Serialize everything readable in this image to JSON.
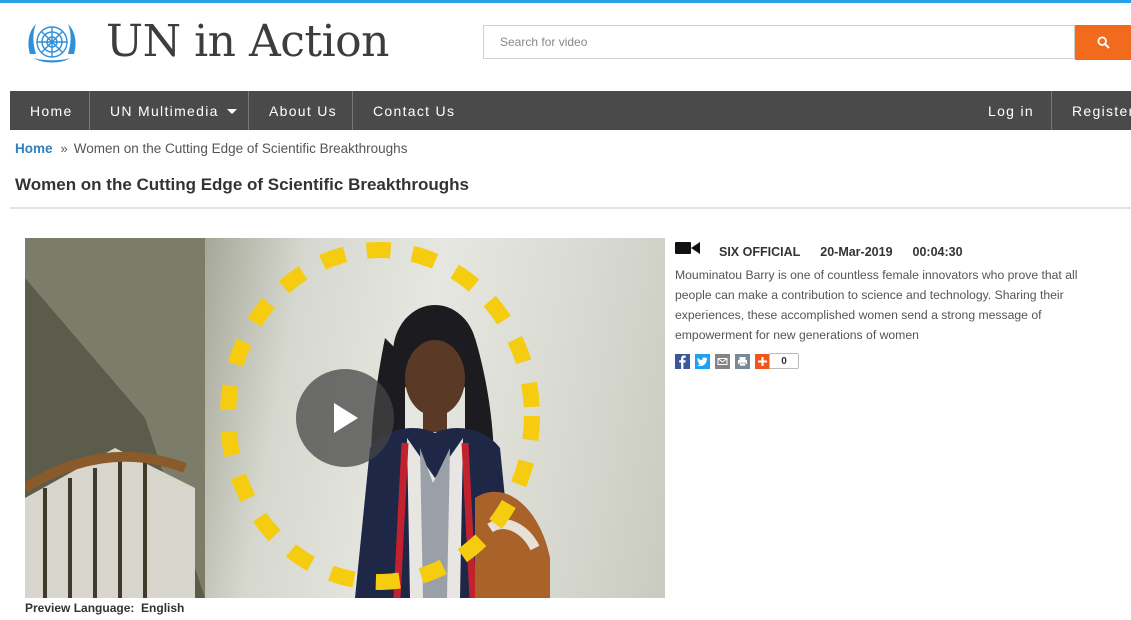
{
  "header": {
    "site_title": "UN in Action",
    "search_placeholder": "Search for video"
  },
  "nav": {
    "items": [
      {
        "label": "Home"
      },
      {
        "label": "UN Multimedia"
      },
      {
        "label": "About Us"
      },
      {
        "label": "Contact Us"
      }
    ],
    "right": [
      {
        "label": "Log in"
      },
      {
        "label": "Register"
      }
    ]
  },
  "breadcrumb": {
    "home": "Home",
    "current": "Women on the Cutting Edge of Scientific Breakthroughs"
  },
  "page_title": "Women on the Cutting Edge of Scientific Breakthroughs",
  "video": {
    "source": "SIX OFFICIAL",
    "date": "20-Mar-2019",
    "duration": "00:04:30",
    "description": "Mouminatou Barry is one of countless female innovators who prove that all people can make a contribution to science and technology. Sharing their experiences, these accomplished women send a strong message of empowerment for new generations of women",
    "share_count": "0"
  },
  "preview_language": {
    "label": "Preview Language:",
    "value": "English"
  },
  "colors": {
    "accent_orange": "#f26b1d",
    "nav_bg": "#4a4a4a",
    "link_blue": "#2f7fc1",
    "top_line": "#2b9fe6",
    "ring_yellow": "#f5cc10"
  }
}
